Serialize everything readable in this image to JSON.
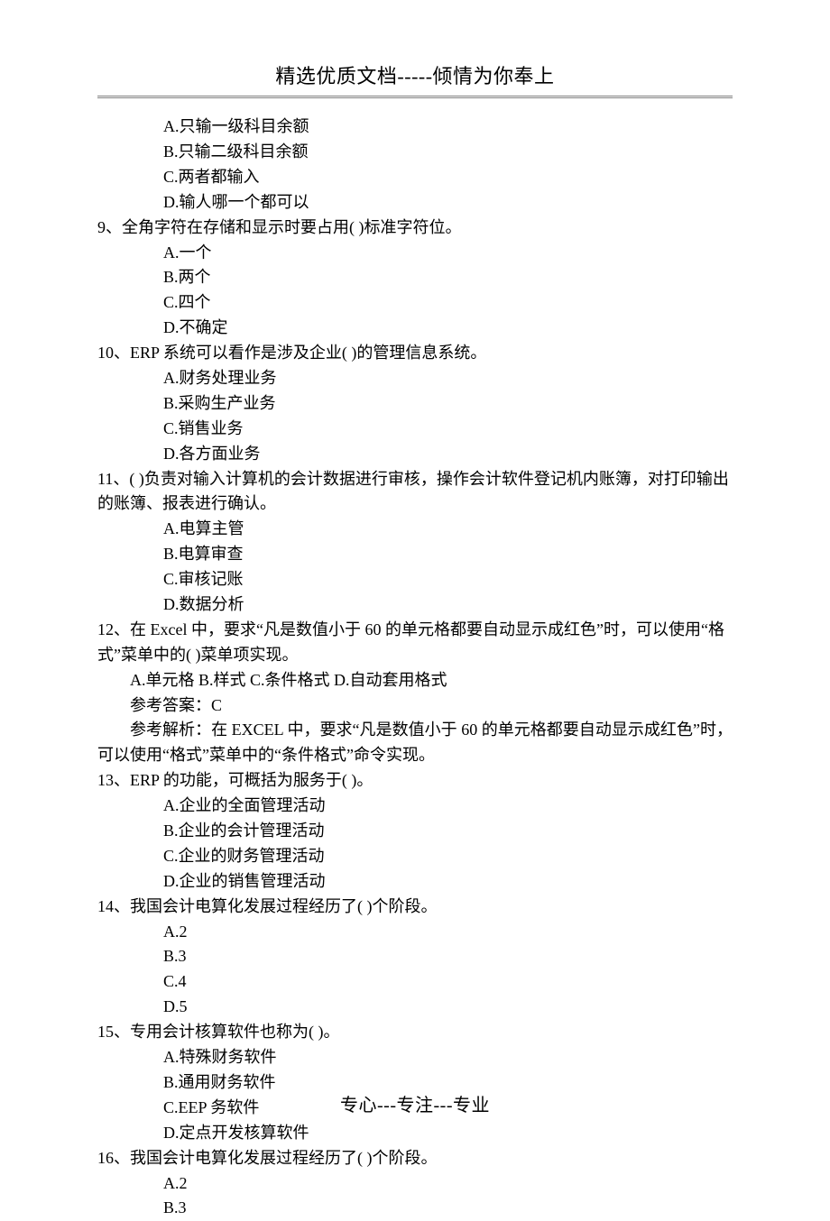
{
  "header": "精选优质文档-----倾情为你奉上",
  "footer": "专心---专注---专业",
  "items": [
    {
      "type": "option",
      "text": "A.只输一级科目余额"
    },
    {
      "type": "option",
      "text": "B.只输二级科目余额"
    },
    {
      "type": "option",
      "text": "C.两者都输入"
    },
    {
      "type": "option",
      "text": "D.输人哪一个都可以"
    },
    {
      "type": "question",
      "text": "9、全角字符在存储和显示时要占用( )标准字符位。"
    },
    {
      "type": "option",
      "text": "A.一个"
    },
    {
      "type": "option",
      "text": "B.两个"
    },
    {
      "type": "option",
      "text": "C.四个"
    },
    {
      "type": "option",
      "text": "D.不确定"
    },
    {
      "type": "question",
      "text": "10、ERP 系统可以看作是涉及企业( )的管理信息系统。"
    },
    {
      "type": "option",
      "text": "A.财务处理业务"
    },
    {
      "type": "option",
      "text": "B.采购生产业务"
    },
    {
      "type": "option",
      "text": "C.销售业务"
    },
    {
      "type": "option",
      "text": "D.各方面业务"
    },
    {
      "type": "question",
      "text": "11、( )负责对输入计算机的会计数据进行审核，操作会计软件登记机内账簿，对打印输出的账簿、报表进行确认。"
    },
    {
      "type": "option",
      "text": "A.电算主管"
    },
    {
      "type": "option",
      "text": "B.电算审查"
    },
    {
      "type": "option",
      "text": "C.审核记账"
    },
    {
      "type": "option",
      "text": "D.数据分析"
    },
    {
      "type": "question",
      "text": "12、在 Excel 中，要求“凡是数值小于 60 的单元格都要自动显示成红色”时，可以使用“格式”菜单中的(    )菜单项实现。"
    },
    {
      "type": "inline-options",
      "text": "A.单元格 B.样式 C.条件格式 D.自动套用格式"
    },
    {
      "type": "answer-line",
      "text": "参考答案：C"
    },
    {
      "type": "explain",
      "text": "参考解析：在 EXCEL 中，要求“凡是数值小于 60 的单元格都要自动显示成红色”时，可以使用“格式”菜单中的“条件格式”命令实现。"
    },
    {
      "type": "question",
      "text": "13、ERP 的功能，可概括为服务于(  )。"
    },
    {
      "type": "option",
      "text": "A.企业的全面管理活动"
    },
    {
      "type": "option",
      "text": "B.企业的会计管理活动"
    },
    {
      "type": "option",
      "text": "C.企业的财务管理活动"
    },
    {
      "type": "option",
      "text": "D.企业的销售管理活动"
    },
    {
      "type": "question",
      "text": "14、我国会计电算化发展过程经历了(  )个阶段。"
    },
    {
      "type": "option",
      "text": "A.2"
    },
    {
      "type": "option",
      "text": "B.3"
    },
    {
      "type": "option",
      "text": "C.4"
    },
    {
      "type": "option",
      "text": "D.5"
    },
    {
      "type": "question",
      "text": "15、专用会计核算软件也称为( )。"
    },
    {
      "type": "option",
      "text": "A.特殊财务软件"
    },
    {
      "type": "option",
      "text": "B.通用财务软件"
    },
    {
      "type": "option",
      "text": "C.EEP 务软件"
    },
    {
      "type": "option",
      "text": "D.定点开发核算软件"
    },
    {
      "type": "question",
      "text": "16、我国会计电算化发展过程经历了(  )个阶段。"
    },
    {
      "type": "option",
      "text": "A.2"
    },
    {
      "type": "option",
      "text": "B.3"
    }
  ]
}
